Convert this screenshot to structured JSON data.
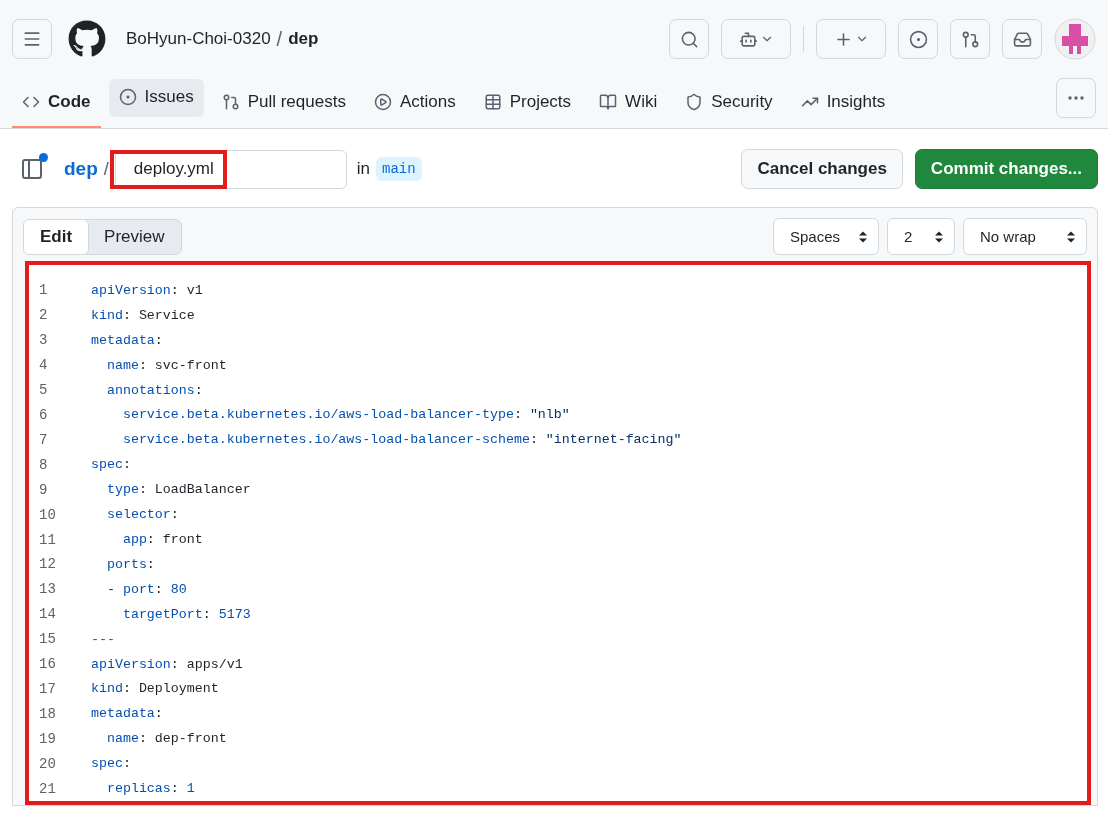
{
  "header": {
    "owner": "BoHyun-Choi-0320",
    "separator": "/",
    "repo": "dep"
  },
  "repo_tabs": [
    {
      "label": "Code",
      "selected": true,
      "hovered": false
    },
    {
      "label": "Issues",
      "selected": false,
      "hovered": true
    },
    {
      "label": "Pull requests",
      "selected": false,
      "hovered": false
    },
    {
      "label": "Actions",
      "selected": false,
      "hovered": false
    },
    {
      "label": "Projects",
      "selected": false,
      "hovered": false
    },
    {
      "label": "Wiki",
      "selected": false,
      "hovered": false
    },
    {
      "label": "Security",
      "selected": false,
      "hovered": false
    },
    {
      "label": "Insights",
      "selected": false,
      "hovered": false
    }
  ],
  "file_bar": {
    "unread_dot": true,
    "repo_link": "dep",
    "separator": "/",
    "filename": "deploy.yml",
    "in_label": "in",
    "branch": "main",
    "buttons": [
      {
        "label": "Cancel changes",
        "kind": "secondary"
      },
      {
        "label": "Commit changes...",
        "kind": "primary"
      }
    ]
  },
  "editor": {
    "modes": [
      {
        "label": "Edit",
        "selected": true
      },
      {
        "label": "Preview",
        "selected": false
      }
    ],
    "selects": [
      {
        "value": "Spaces"
      },
      {
        "value": "2"
      },
      {
        "value": "No wrap"
      }
    ],
    "lines": [
      {
        "number": "1",
        "tokens": [
          {
            "kind": "key",
            "text": "apiVersion"
          },
          {
            "kind": "punct",
            "text": ": "
          },
          {
            "kind": "plain",
            "text": "v1"
          }
        ]
      },
      {
        "number": "2",
        "tokens": [
          {
            "kind": "key",
            "text": "kind"
          },
          {
            "kind": "punct",
            "text": ": "
          },
          {
            "kind": "plain",
            "text": "Service"
          }
        ]
      },
      {
        "number": "3",
        "tokens": [
          {
            "kind": "key",
            "text": "metadata"
          },
          {
            "kind": "punct",
            "text": ":"
          }
        ]
      },
      {
        "number": "4",
        "tokens": [
          {
            "kind": "key",
            "text": "  name"
          },
          {
            "kind": "punct",
            "text": ": "
          },
          {
            "kind": "plain",
            "text": "svc-front"
          }
        ]
      },
      {
        "number": "5",
        "tokens": [
          {
            "kind": "key",
            "text": "  annotations"
          },
          {
            "kind": "punct",
            "text": ":"
          }
        ]
      },
      {
        "number": "6",
        "tokens": [
          {
            "kind": "key",
            "text": "    service.beta.kubernetes.io/aws-load-balancer-type"
          },
          {
            "kind": "punct",
            "text": ": "
          },
          {
            "kind": "string",
            "text": "\"nlb\""
          }
        ]
      },
      {
        "number": "7",
        "tokens": [
          {
            "kind": "key",
            "text": "    service.beta.kubernetes.io/aws-load-balancer-scheme"
          },
          {
            "kind": "punct",
            "text": ": "
          },
          {
            "kind": "string",
            "text": "\"internet-facing\""
          }
        ]
      },
      {
        "number": "8",
        "tokens": [
          {
            "kind": "key",
            "text": "spec"
          },
          {
            "kind": "punct",
            "text": ":"
          }
        ]
      },
      {
        "number": "9",
        "tokens": [
          {
            "kind": "key",
            "text": "  type"
          },
          {
            "kind": "punct",
            "text": ": "
          },
          {
            "kind": "plain",
            "text": "LoadBalancer"
          }
        ]
      },
      {
        "number": "10",
        "tokens": [
          {
            "kind": "key",
            "text": "  selector"
          },
          {
            "kind": "punct",
            "text": ":"
          }
        ]
      },
      {
        "number": "11",
        "tokens": [
          {
            "kind": "key",
            "text": "    app"
          },
          {
            "kind": "punct",
            "text": ": "
          },
          {
            "kind": "plain",
            "text": "front"
          }
        ]
      },
      {
        "number": "12",
        "tokens": [
          {
            "kind": "key",
            "text": "  ports"
          },
          {
            "kind": "punct",
            "text": ":"
          }
        ]
      },
      {
        "number": "13",
        "tokens": [
          {
            "kind": "punct",
            "text": "  - "
          },
          {
            "kind": "key",
            "text": "port"
          },
          {
            "kind": "punct",
            "text": ": "
          },
          {
            "kind": "number",
            "text": "80"
          }
        ]
      },
      {
        "number": "14",
        "tokens": [
          {
            "kind": "key",
            "text": "    targetPort"
          },
          {
            "kind": "punct",
            "text": ": "
          },
          {
            "kind": "number",
            "text": "5173"
          }
        ]
      },
      {
        "number": "15",
        "tokens": [
          {
            "kind": "marker",
            "text": "---"
          }
        ]
      },
      {
        "number": "16",
        "tokens": [
          {
            "kind": "key",
            "text": "apiVersion"
          },
          {
            "kind": "punct",
            "text": ": "
          },
          {
            "kind": "plain",
            "text": "apps/v1"
          }
        ]
      },
      {
        "number": "17",
        "tokens": [
          {
            "kind": "key",
            "text": "kind"
          },
          {
            "kind": "punct",
            "text": ": "
          },
          {
            "kind": "plain",
            "text": "Deployment"
          }
        ]
      },
      {
        "number": "18",
        "tokens": [
          {
            "kind": "key",
            "text": "metadata"
          },
          {
            "kind": "punct",
            "text": ":"
          }
        ]
      },
      {
        "number": "19",
        "tokens": [
          {
            "kind": "key",
            "text": "  name"
          },
          {
            "kind": "punct",
            "text": ": "
          },
          {
            "kind": "plain",
            "text": "dep-front"
          }
        ]
      },
      {
        "number": "20",
        "tokens": [
          {
            "kind": "key",
            "text": "spec"
          },
          {
            "kind": "punct",
            "text": ":"
          }
        ]
      },
      {
        "number": "21",
        "tokens": [
          {
            "kind": "key",
            "text": "  replicas"
          },
          {
            "kind": "punct",
            "text": ": "
          },
          {
            "kind": "number",
            "text": "1"
          }
        ]
      }
    ]
  }
}
